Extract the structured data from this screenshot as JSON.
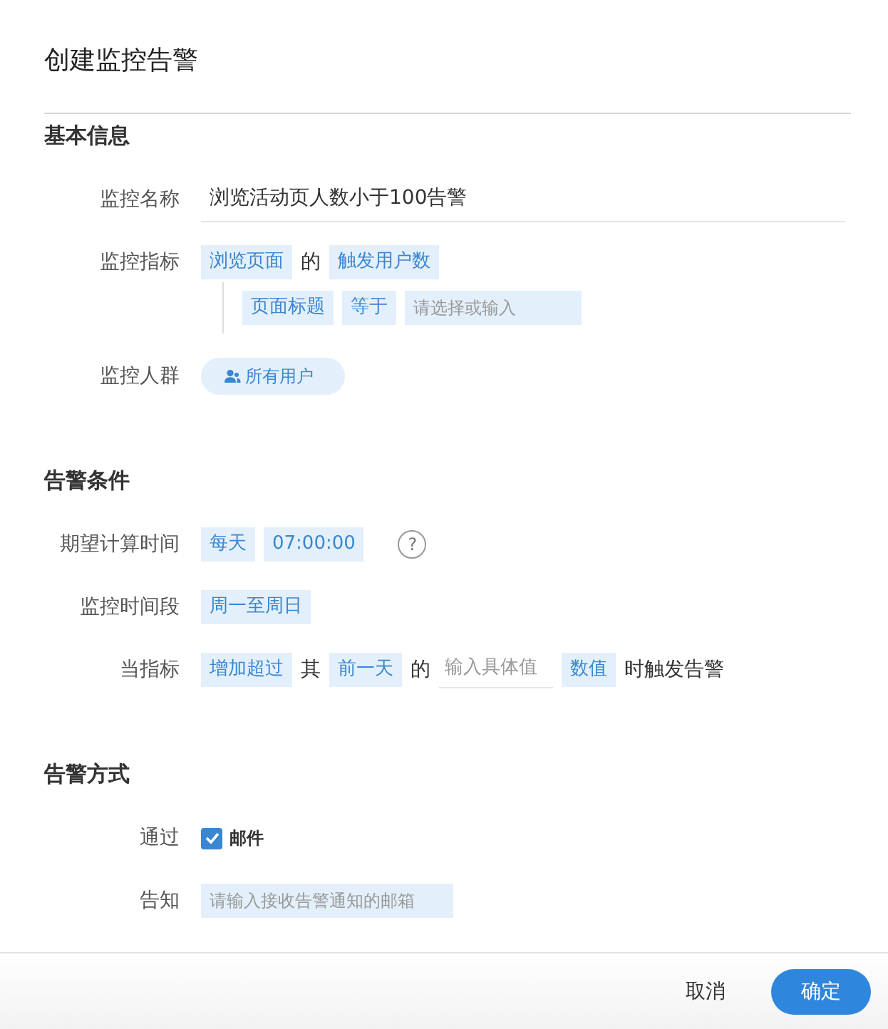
{
  "dialog": {
    "title": "创建监控告警"
  },
  "sections": [
    {
      "title": "基本信息",
      "rows": [
        {
          "kind": "field",
          "label": "监控名称",
          "parts": [
            {
              "kind": "value",
              "text": "浏览活动页人数小于100告警"
            }
          ]
        },
        {
          "kind": "field",
          "label": "监控指标",
          "parts": [
            {
              "kind": "chip",
              "text": "浏览页面"
            },
            {
              "kind": "word",
              "text": "的"
            },
            {
              "kind": "chip",
              "text": "触发用户数"
            }
          ]
        },
        {
          "kind": "filter",
          "parts": [
            {
              "kind": "chip",
              "text": "页面标题"
            },
            {
              "kind": "chip",
              "text": "等于"
            },
            {
              "kind": "chip-input",
              "placeholder": "请选择或输入"
            }
          ]
        },
        {
          "kind": "field",
          "label": "监控人群",
          "parts": [
            {
              "kind": "pill",
              "text": "所有用户"
            }
          ]
        }
      ]
    },
    {
      "title": "告警条件",
      "rows": [
        {
          "kind": "field",
          "label": "期望计算时间",
          "parts": [
            {
              "kind": "chip",
              "text": "每天"
            },
            {
              "kind": "chip",
              "text": "07:00:00"
            },
            {
              "kind": "help",
              "text": "?"
            }
          ]
        },
        {
          "kind": "field",
          "label": "监控时间段",
          "parts": [
            {
              "kind": "chip",
              "text": "周一至周日"
            }
          ]
        },
        {
          "kind": "field",
          "label": "当指标",
          "parts": [
            {
              "kind": "chip",
              "text": "增加超过"
            },
            {
              "kind": "word",
              "text": "其"
            },
            {
              "kind": "chip",
              "text": "前一天"
            },
            {
              "kind": "word",
              "text": "的"
            },
            {
              "kind": "input",
              "placeholder": "输入具体值"
            },
            {
              "kind": "chip",
              "text": "数值"
            },
            {
              "kind": "word",
              "text": "时触发告警"
            }
          ]
        }
      ]
    },
    {
      "title": "告警方式",
      "rows": [
        {
          "kind": "field",
          "label": "通过",
          "parts": [
            {
              "kind": "checkbox",
              "text": "邮件",
              "checked": true
            }
          ]
        },
        {
          "kind": "field",
          "label": "告知",
          "parts": [
            {
              "kind": "chip-input",
              "placeholder": "请输入接收告警通知的邮箱"
            }
          ]
        }
      ]
    }
  ],
  "footer": {
    "cancel": "取消",
    "confirm": "确定"
  }
}
